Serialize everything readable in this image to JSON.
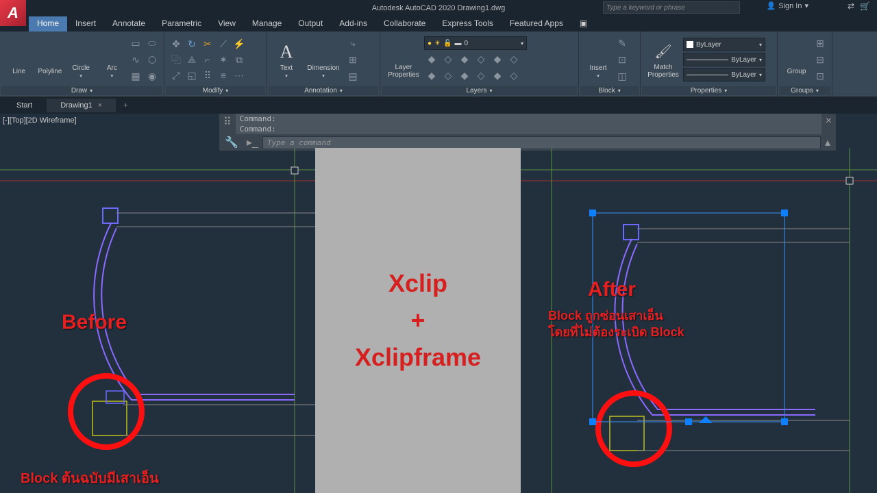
{
  "title": "Autodesk AutoCAD 2020   Drawing1.dwg",
  "app_letter": "A",
  "search_placeholder": "Type a keyword or phrase",
  "signin": "Sign In",
  "menu": {
    "items": [
      "Home",
      "Insert",
      "Annotate",
      "Parametric",
      "View",
      "Manage",
      "Output",
      "Add-ins",
      "Collaborate",
      "Express Tools",
      "Featured Apps"
    ],
    "active": "Home"
  },
  "ribbon": {
    "draw": {
      "title": "Draw",
      "tools": [
        "Line",
        "Polyline",
        "Circle",
        "Arc"
      ]
    },
    "modify": {
      "title": "Modify"
    },
    "annotation": {
      "title": "Annotation",
      "text": "Text",
      "dim": "Dimension"
    },
    "layers": {
      "title": "Layers",
      "props": "Layer\nProperties",
      "current": "0"
    },
    "block": {
      "title": "Block",
      "insert": "Insert"
    },
    "properties": {
      "title": "Properties",
      "match": "Match\nProperties",
      "bylayer": "ByLayer"
    },
    "groups": {
      "title": "Groups",
      "group": "Group"
    }
  },
  "tabs": {
    "start": "Start",
    "drawing": "Drawing1"
  },
  "view_label": "[-][Top][2D Wireframe]",
  "cmd": {
    "h1": "Command:",
    "h2": "Command:",
    "placeholder": "Type a command"
  },
  "banner": {
    "l1": "Xclip",
    "l2": "+",
    "l3": "Xclipframe"
  },
  "anno": {
    "before": "Before",
    "before_sub": "Block ต้นฉบับมีเสาเอ็น",
    "after": "After",
    "after_sub1": "Block ถูกซ่อนเสาเอ็น",
    "after_sub2": "โดยที่ไม่ต้องระเบิด Block"
  }
}
